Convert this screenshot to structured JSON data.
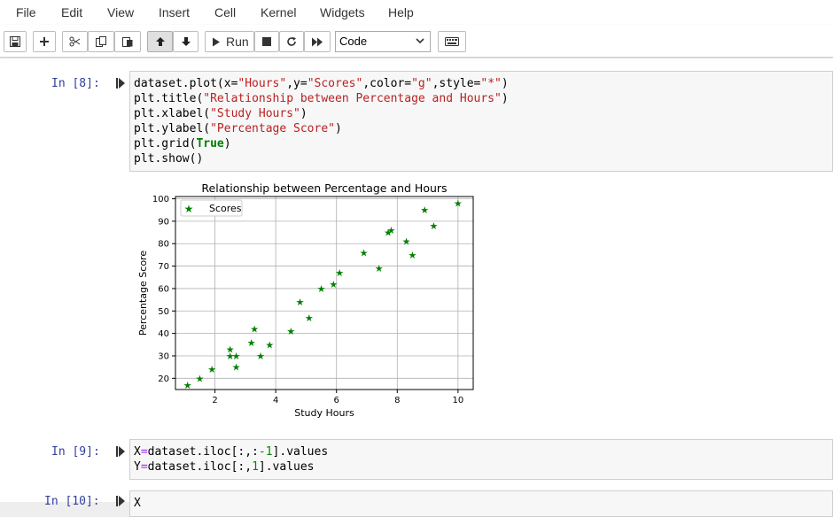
{
  "menu": {
    "items": [
      "File",
      "Edit",
      "View",
      "Insert",
      "Cell",
      "Kernel",
      "Widgets",
      "Help"
    ]
  },
  "toolbar": {
    "run_label": "Run",
    "cell_type": "Code",
    "icons": [
      "save-icon",
      "plus-icon",
      "cut-icon",
      "copy-icon",
      "paste-icon",
      "arrow-up-icon",
      "arrow-down-icon",
      "run-icon",
      "stop-icon",
      "restart-icon",
      "fast-forward-icon",
      "keyboard-icon"
    ]
  },
  "cells": [
    {
      "prompt": "In [8]:",
      "lines": [
        [
          [
            "dataset.plot(x=",
            ""
          ],
          [
            "\"Hours\"",
            "s"
          ],
          [
            ",y=",
            ""
          ],
          [
            "\"Scores\"",
            "s"
          ],
          [
            ",color=",
            ""
          ],
          [
            "\"g\"",
            "s"
          ],
          [
            ",style=",
            ""
          ],
          [
            "\"*\"",
            "s"
          ],
          [
            ")",
            ""
          ]
        ],
        [
          [
            "plt.title(",
            ""
          ],
          [
            "\"Relationship between Percentage and Hours\"",
            "s"
          ],
          [
            ")",
            ""
          ]
        ],
        [
          [
            "plt.xlabel(",
            ""
          ],
          [
            "\"Study Hours\"",
            "s"
          ],
          [
            ")",
            ""
          ]
        ],
        [
          [
            "plt.ylabel(",
            ""
          ],
          [
            "\"Percentage Score\"",
            "s"
          ],
          [
            ")",
            ""
          ]
        ],
        [
          [
            "plt.grid(",
            ""
          ],
          [
            "True",
            "k"
          ],
          [
            ")",
            ""
          ]
        ],
        [
          [
            "plt.show()",
            ""
          ]
        ]
      ]
    },
    {
      "prompt": "In [9]:",
      "lines": [
        [
          [
            "X",
            ""
          ],
          [
            "=",
            "o"
          ],
          [
            "dataset.iloc[:,:",
            ""
          ],
          [
            "-1",
            "n"
          ],
          [
            "].values",
            ""
          ]
        ],
        [
          [
            "Y",
            ""
          ],
          [
            "=",
            "o"
          ],
          [
            "dataset.iloc[:,",
            ""
          ],
          [
            "1",
            "n"
          ],
          [
            "].values",
            ""
          ]
        ]
      ]
    },
    {
      "prompt": "In [10]:",
      "lines": [
        [
          [
            "X",
            ""
          ]
        ]
      ]
    }
  ],
  "chart_data": {
    "type": "scatter",
    "title": "Relationship between Percentage and Hours",
    "xlabel": "Study Hours",
    "ylabel": "Percentage Score",
    "xlim": [
      0.7,
      10.5
    ],
    "ylim": [
      15,
      101
    ],
    "xticks": [
      2,
      4,
      6,
      8,
      10
    ],
    "yticks": [
      20,
      30,
      40,
      50,
      60,
      70,
      80,
      90,
      100
    ],
    "grid": true,
    "legend": "top-left",
    "marker": "*",
    "color": "#008000",
    "series": [
      {
        "name": "Scores",
        "points": [
          [
            1.1,
            17
          ],
          [
            1.5,
            20
          ],
          [
            1.9,
            24
          ],
          [
            2.5,
            30
          ],
          [
            2.5,
            33
          ],
          [
            2.7,
            25
          ],
          [
            2.7,
            30
          ],
          [
            3.2,
            36
          ],
          [
            3.3,
            42
          ],
          [
            3.5,
            30
          ],
          [
            3.8,
            35
          ],
          [
            4.5,
            41
          ],
          [
            4.8,
            54
          ],
          [
            5.1,
            47
          ],
          [
            5.5,
            60
          ],
          [
            5.9,
            62
          ],
          [
            6.1,
            67
          ],
          [
            6.9,
            76
          ],
          [
            7.4,
            69
          ],
          [
            7.7,
            85
          ],
          [
            7.8,
            86
          ],
          [
            8.3,
            81
          ],
          [
            8.5,
            75
          ],
          [
            8.9,
            95
          ],
          [
            9.2,
            88
          ],
          [
            10.0,
            98
          ]
        ]
      }
    ]
  }
}
